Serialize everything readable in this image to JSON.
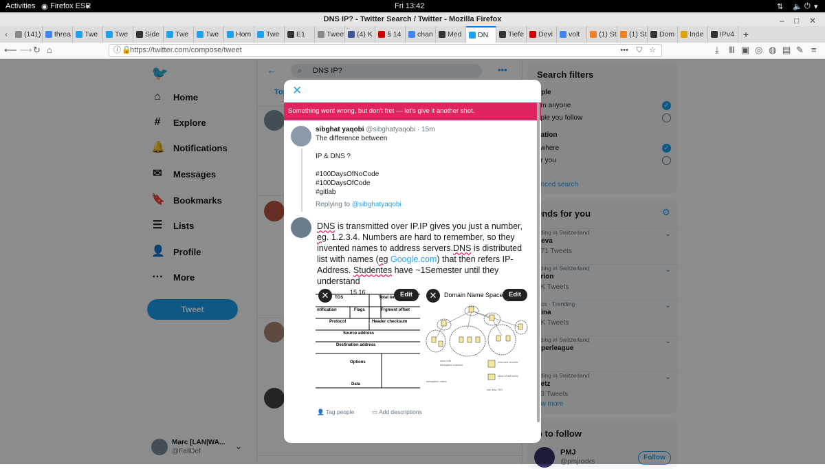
{
  "gnome": {
    "activities": "Activities",
    "app": "Firefox ESR",
    "clock": "Fri 13:42"
  },
  "window": {
    "title": "DNS IP? - Twitter Search / Twitter - Mozilla Firefox"
  },
  "tabs": [
    {
      "label": "(141)",
      "color": "#888"
    },
    {
      "label": "threa",
      "color": "#4285f4"
    },
    {
      "label": "Twe",
      "color": "#1da1f2"
    },
    {
      "label": "Twe",
      "color": "#1da1f2"
    },
    {
      "label": "Side",
      "color": "#333"
    },
    {
      "label": "Twe",
      "color": "#1da1f2"
    },
    {
      "label": "Twe",
      "color": "#1da1f2"
    },
    {
      "label": "Hom",
      "color": "#1da1f2"
    },
    {
      "label": "Twe",
      "color": "#1da1f2"
    },
    {
      "label": "E1",
      "color": "#333"
    },
    {
      "label": "TweetD",
      "color": "#888"
    },
    {
      "label": "(4) K",
      "color": "#3b5998"
    },
    {
      "label": "§ 14",
      "color": "#c00"
    },
    {
      "label": "chan",
      "color": "#4285f4"
    },
    {
      "label": "Med",
      "color": "#333"
    },
    {
      "label": "DN",
      "color": "#1da1f2"
    },
    {
      "label": "Tiefe",
      "color": "#333"
    },
    {
      "label": "Devi",
      "color": "#c00"
    },
    {
      "label": "volt",
      "color": "#4285f4"
    },
    {
      "label": "(1) St",
      "color": "#f48024"
    },
    {
      "label": "(1) St",
      "color": "#f48024"
    },
    {
      "label": "Dom",
      "color": "#333"
    },
    {
      "label": "Inde",
      "color": "#e0a000"
    },
    {
      "label": "IPv4",
      "color": "#333"
    }
  ],
  "url": "https://twitter.com/compose/tweet",
  "nav": {
    "home": "Home",
    "explore": "Explore",
    "notifications": "Notifications",
    "messages": "Messages",
    "bookmarks": "Bookmarks",
    "lists": "Lists",
    "profile": "Profile",
    "more": "More",
    "tweet": "Tweet"
  },
  "account": {
    "name": "Marc [LAN|WA...",
    "handle": "@FailDef"
  },
  "search": {
    "query": "DNS IP?",
    "tab": "Top"
  },
  "right": {
    "filters_title": "Search filters",
    "people": "ople",
    "from_anyone": "om anyone",
    "people_follow": "ople you follow",
    "location": "cation",
    "anywhere": "ywhere",
    "near_you": "ar you",
    "advanced": "anced search",
    "trends_title": "ends for you",
    "trends": [
      {
        "ctx": "nding in Switzerland",
        "name": "neva",
        "count": "971 Tweets"
      },
      {
        "ctx": "nding in Switzerland",
        "name": "arion",
        "count": "8K Tweets"
      },
      {
        "ctx": "itics · Trending",
        "name": "hina",
        "count": "3K Tweets"
      },
      {
        "ctx": "nding in Switzerland",
        "name": "uperleague",
        "count": ""
      },
      {
        "ctx": "nding in Switzerland",
        "name": "setz",
        "count": "13 Tweets"
      }
    ],
    "show_more": "ow more",
    "who_title": "o to follow",
    "who_name": "PMJ",
    "who_handle": "@pmjrocks",
    "follow": "Follow"
  },
  "modal": {
    "error": "Something went wrong, but don't fret — let's give it another shot.",
    "reply_name": "sibghat yaqobi",
    "reply_handle": "@sibghatyaqobi",
    "reply_time": "15m",
    "reply_lines": [
      "The difference between",
      "",
      "IP & DNS ?",
      "",
      "#100DaysOfNoCode",
      "#100DaysOfCode",
      "#gitlab"
    ],
    "replying_prefix": "Replying to",
    "replying_handle": "@sibghatyaqobi",
    "compose": {
      "p1": "DNS",
      "p2": " is transmitted over IP.IP gives you just a number, ",
      "p3": "eg",
      "p4": ". 1.2.3.4. Numbers are hard to remember, so they invented names to address servers.",
      "p5": "DNS",
      "p6": " is distributed list with names (",
      "p7": "eg",
      "p8": " ",
      "p9": "Google.com",
      "p10": ") that then refers IP-Address. ",
      "p11": "Studentes",
      "p12": " have ~1Semester until they understand"
    },
    "image1": {
      "edit": "Edit",
      "header": "15 16",
      "rows": [
        "TOS",
        "Total length",
        "ntification",
        "Flags",
        "Frgment offset",
        "Protocol",
        "Header checksum",
        "Source address",
        "Destination address",
        "Options",
        "Data"
      ]
    },
    "image2": {
      "edit": "Edit",
      "title": "Domain Name Space"
    },
    "tag_people": "Tag people",
    "add_descriptions": "Add descriptions"
  }
}
